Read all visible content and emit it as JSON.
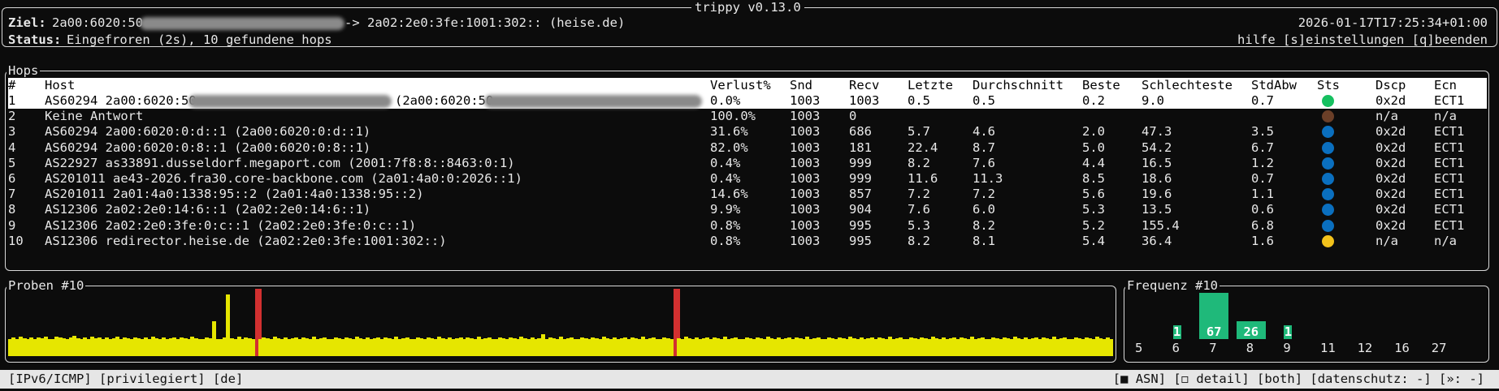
{
  "window": {
    "title": "trippy v0.13.0"
  },
  "header": {
    "target_label": "Ziel:",
    "target_value_prefix": "2a00:6020:50",
    "target_value_suffix": "-> 2a02:2e0:3fe:1001:302:: (heise.de)",
    "status_label": "Status:",
    "status_value": "Eingefroren (2s), 10 gefundene hops",
    "timestamp": "2026-01-17T17:25:34+01:00",
    "help_hint": "hilfe [s]einstellungen [q]beenden"
  },
  "hops_panel": {
    "title": "Hops",
    "columns": [
      "#",
      "Host",
      "Verlust%",
      "Snd",
      "Recv",
      "Letzte",
      "Durchschnitt",
      "Beste",
      "Schlechteste",
      "StdAbw",
      "Sts",
      "Dscp",
      "Ecn"
    ],
    "rows": [
      {
        "num": "1",
        "host": "AS60294 2a00:6020:50",
        "host_extra": "(2a00:6020:50",
        "loss": "0.0%",
        "snd": "1003",
        "recv": "1003",
        "last": "0.5",
        "avg": "0.5",
        "best": "0.2",
        "worst": "9.0",
        "stddev": "0.7",
        "sts_color": "#16c060",
        "dscp": "0x2d",
        "ecn": "ECT1",
        "selected": true
      },
      {
        "num": "2",
        "host": "Keine Antwort",
        "loss": "100.0%",
        "snd": "1003",
        "recv": "0",
        "last": "",
        "avg": "",
        "best": "",
        "worst": "",
        "stddev": "",
        "sts_color": "#6b3f28",
        "dscp": "n/a",
        "ecn": "n/a"
      },
      {
        "num": "3",
        "host": "AS60294 2a00:6020:0:d::1 (2a00:6020:0:d::1)",
        "loss": "31.6%",
        "snd": "1003",
        "recv": "686",
        "last": "5.7",
        "avg": "4.6",
        "best": "2.0",
        "worst": "47.3",
        "stddev": "3.5",
        "sts_color": "#0a6fbf",
        "dscp": "0x2d",
        "ecn": "ECT1"
      },
      {
        "num": "4",
        "host": "AS60294 2a00:6020:0:8::1 (2a00:6020:0:8::1)",
        "loss": "82.0%",
        "snd": "1003",
        "recv": "181",
        "last": "22.4",
        "avg": "8.7",
        "best": "5.0",
        "worst": "54.2",
        "stddev": "6.7",
        "sts_color": "#0a6fbf",
        "dscp": "0x2d",
        "ecn": "ECT1"
      },
      {
        "num": "5",
        "host": "AS22927 as33891.dusseldorf.megaport.com (2001:7f8:8::8463:0:1)",
        "loss": "0.4%",
        "snd": "1003",
        "recv": "999",
        "last": "8.2",
        "avg": "7.6",
        "best": "4.4",
        "worst": "16.5",
        "stddev": "1.2",
        "sts_color": "#0a6fbf",
        "dscp": "0x2d",
        "ecn": "ECT1"
      },
      {
        "num": "6",
        "host": "AS201011 ae43-2026.fra30.core-backbone.com (2a01:4a0:0:2026::1)",
        "loss": "0.4%",
        "snd": "1003",
        "recv": "999",
        "last": "11.6",
        "avg": "11.3",
        "best": "8.5",
        "worst": "18.6",
        "stddev": "0.7",
        "sts_color": "#0a6fbf",
        "dscp": "0x2d",
        "ecn": "ECT1"
      },
      {
        "num": "7",
        "host": "AS201011 2a01:4a0:1338:95::2 (2a01:4a0:1338:95::2)",
        "loss": "14.6%",
        "snd": "1003",
        "recv": "857",
        "last": "7.2",
        "avg": "7.2",
        "best": "5.6",
        "worst": "19.6",
        "stddev": "1.1",
        "sts_color": "#0a6fbf",
        "dscp": "0x2d",
        "ecn": "ECT1"
      },
      {
        "num": "8",
        "host": "AS12306 2a02:2e0:14:6::1 (2a02:2e0:14:6::1)",
        "loss": "9.9%",
        "snd": "1003",
        "recv": "904",
        "last": "7.6",
        "avg": "6.0",
        "best": "5.3",
        "worst": "13.5",
        "stddev": "0.6",
        "sts_color": "#0a6fbf",
        "dscp": "0x2d",
        "ecn": "ECT1"
      },
      {
        "num": "9",
        "host": "AS12306 2a02:2e0:3fe:0:c::1 (2a02:2e0:3fe:0:c::1)",
        "loss": "0.8%",
        "snd": "1003",
        "recv": "995",
        "last": "5.3",
        "avg": "8.2",
        "best": "5.2",
        "worst": "155.4",
        "stddev": "6.8",
        "sts_color": "#0a6fbf",
        "dscp": "0x2d",
        "ecn": "ECT1"
      },
      {
        "num": "10",
        "host": "AS12306 redirector.heise.de (2a02:2e0:3fe:1001:302::)",
        "loss": "0.8%",
        "snd": "1003",
        "recv": "995",
        "last": "8.2",
        "avg": "8.1",
        "best": "5.4",
        "worst": "36.4",
        "stddev": "1.6",
        "sts_color": "#f2c21b",
        "dscp": "n/a",
        "ecn": "n/a"
      }
    ]
  },
  "samples_panel": {
    "title": "Proben #10",
    "bar_color": "#e6e600",
    "spike_color": "#d23030",
    "levels": [
      0.35,
      0.38,
      0.36,
      0.4,
      0.37,
      0.35,
      0.39,
      0.36,
      0.38,
      0.37,
      0.41,
      0.36,
      0.35,
      0.4,
      0.38,
      0.37,
      0.36,
      0.39,
      0.42,
      0.37,
      0.35,
      0.38,
      0.36,
      0.4,
      0.37,
      0.39,
      0.36,
      0.38,
      0.35,
      0.37,
      0.4,
      0.36,
      0.38,
      0.37,
      0.36,
      0.39,
      0.37,
      0.35,
      0.38,
      0.36,
      0.4,
      0.37,
      0.36,
      0.38,
      0.35,
      0.37,
      0.39,
      0.36,
      0.38,
      0.37,
      0.36,
      0.4,
      0.37,
      0.35,
      0.36,
      0.38,
      0.37,
      0.72,
      0.36,
      0.35,
      0.38,
      1.28,
      0.37,
      0.36,
      0.4,
      0.36,
      0.38,
      0.37,
      0.35,
      0.39,
      0.36,
      0.38,
      0.37,
      0.36,
      0.4,
      0.37,
      0.35,
      0.38,
      0.36,
      0.37,
      0.39,
      0.36,
      0.38,
      0.37,
      0.35,
      0.4,
      0.36,
      0.37,
      0.38,
      0.36,
      0.35,
      0.39,
      0.37,
      0.36,
      0.38,
      0.37,
      0.36,
      0.4,
      0.37,
      0.35,
      0.38,
      0.36,
      0.37,
      0.39,
      0.36,
      0.38,
      0.37,
      0.35,
      0.4,
      0.36,
      0.37,
      0.38,
      0.36,
      0.35,
      0.39,
      0.37,
      0.36,
      0.38,
      0.37,
      0.36,
      0.4,
      0.37,
      0.35,
      0.38,
      0.36,
      0.37,
      0.39,
      0.36,
      0.38,
      0.37,
      0.35,
      0.4,
      0.36,
      0.37,
      0.38,
      0.36,
      0.35,
      0.39,
      0.37,
      0.36,
      0.38,
      0.37,
      0.36,
      0.4,
      0.37,
      0.35,
      0.38,
      0.36,
      0.37,
      0.45,
      0.36,
      0.38,
      0.37,
      0.35,
      0.4,
      0.36,
      0.37,
      0.38,
      0.36,
      0.35,
      0.39,
      0.37,
      0.36,
      0.38,
      0.37,
      0.36,
      0.4,
      0.37,
      0.35,
      0.38,
      0.36,
      0.37,
      0.39,
      0.36,
      0.38,
      0.37,
      0.35,
      0.4,
      0.36,
      0.37,
      0.38,
      0.36,
      0.35,
      0.39,
      0.37,
      0.36,
      0.38,
      0.37,
      0.36,
      0.4,
      0.37,
      0.35,
      0.38,
      0.36,
      0.37,
      0.39,
      0.36,
      0.38,
      0.37,
      0.35,
      0.4,
      0.36,
      0.37,
      0.38,
      0.36,
      0.35,
      0.39,
      0.37,
      0.36,
      0.38,
      0.37,
      0.36,
      0.4,
      0.37,
      0.35,
      0.38,
      0.36,
      0.37,
      0.39,
      0.36,
      0.38,
      0.37,
      0.35,
      0.4,
      0.36,
      0.37,
      0.38,
      0.36,
      0.35,
      0.39,
      0.37,
      0.36,
      0.38,
      0.37,
      0.36,
      0.4,
      0.37,
      0.35,
      0.38,
      0.36,
      0.37,
      0.39,
      0.36,
      0.38,
      0.37,
      0.35,
      0.4,
      0.36,
      0.37,
      0.38,
      0.36,
      0.35,
      0.39,
      0.37,
      0.36,
      0.38,
      0.37,
      0.36,
      0.4,
      0.37,
      0.35,
      0.38,
      0.36,
      0.37,
      0.39,
      0.36,
      0.38,
      0.37,
      0.35,
      0.4,
      0.36,
      0.37,
      0.38,
      0.36,
      0.35,
      0.39,
      0.37,
      0.36,
      0.38,
      0.37,
      0.36,
      0.4,
      0.37,
      0.35,
      0.38,
      0.36,
      0.37,
      0.39,
      0.36,
      0.38,
      0.37,
      0.35,
      0.4,
      0.36,
      0.37,
      0.38,
      0.36,
      0.35,
      0.39,
      0.37,
      0.36,
      0.38,
      0.37,
      0.36,
      0.4,
      0.37,
      0.35,
      0.38,
      0.36
    ],
    "spike_indices": [
      69,
      186
    ]
  },
  "frequency_panel": {
    "title": "Frequenz #10",
    "bar_color": "#1fb97a",
    "buckets": [
      {
        "label": "5",
        "count": 0,
        "count_label": ""
      },
      {
        "label": "6",
        "count": 1,
        "count_label": "1"
      },
      {
        "label": "7",
        "count": 67,
        "count_label": "67"
      },
      {
        "label": "8",
        "count": 26,
        "count_label": "26"
      },
      {
        "label": "9",
        "count": 1,
        "count_label": "1"
      },
      {
        "label": "11",
        "count": 0,
        "count_label": ""
      },
      {
        "label": "12",
        "count": 0,
        "count_label": ""
      },
      {
        "label": "16",
        "count": 0,
        "count_label": ""
      },
      {
        "label": "27",
        "count": 0,
        "count_label": ""
      }
    ]
  },
  "statusbar": {
    "left": "[IPv6/ICMP] [privilegiert] [de]",
    "right": "[■ ASN] [◻ detail] [both] [datenschutz: -] [»: -]"
  }
}
